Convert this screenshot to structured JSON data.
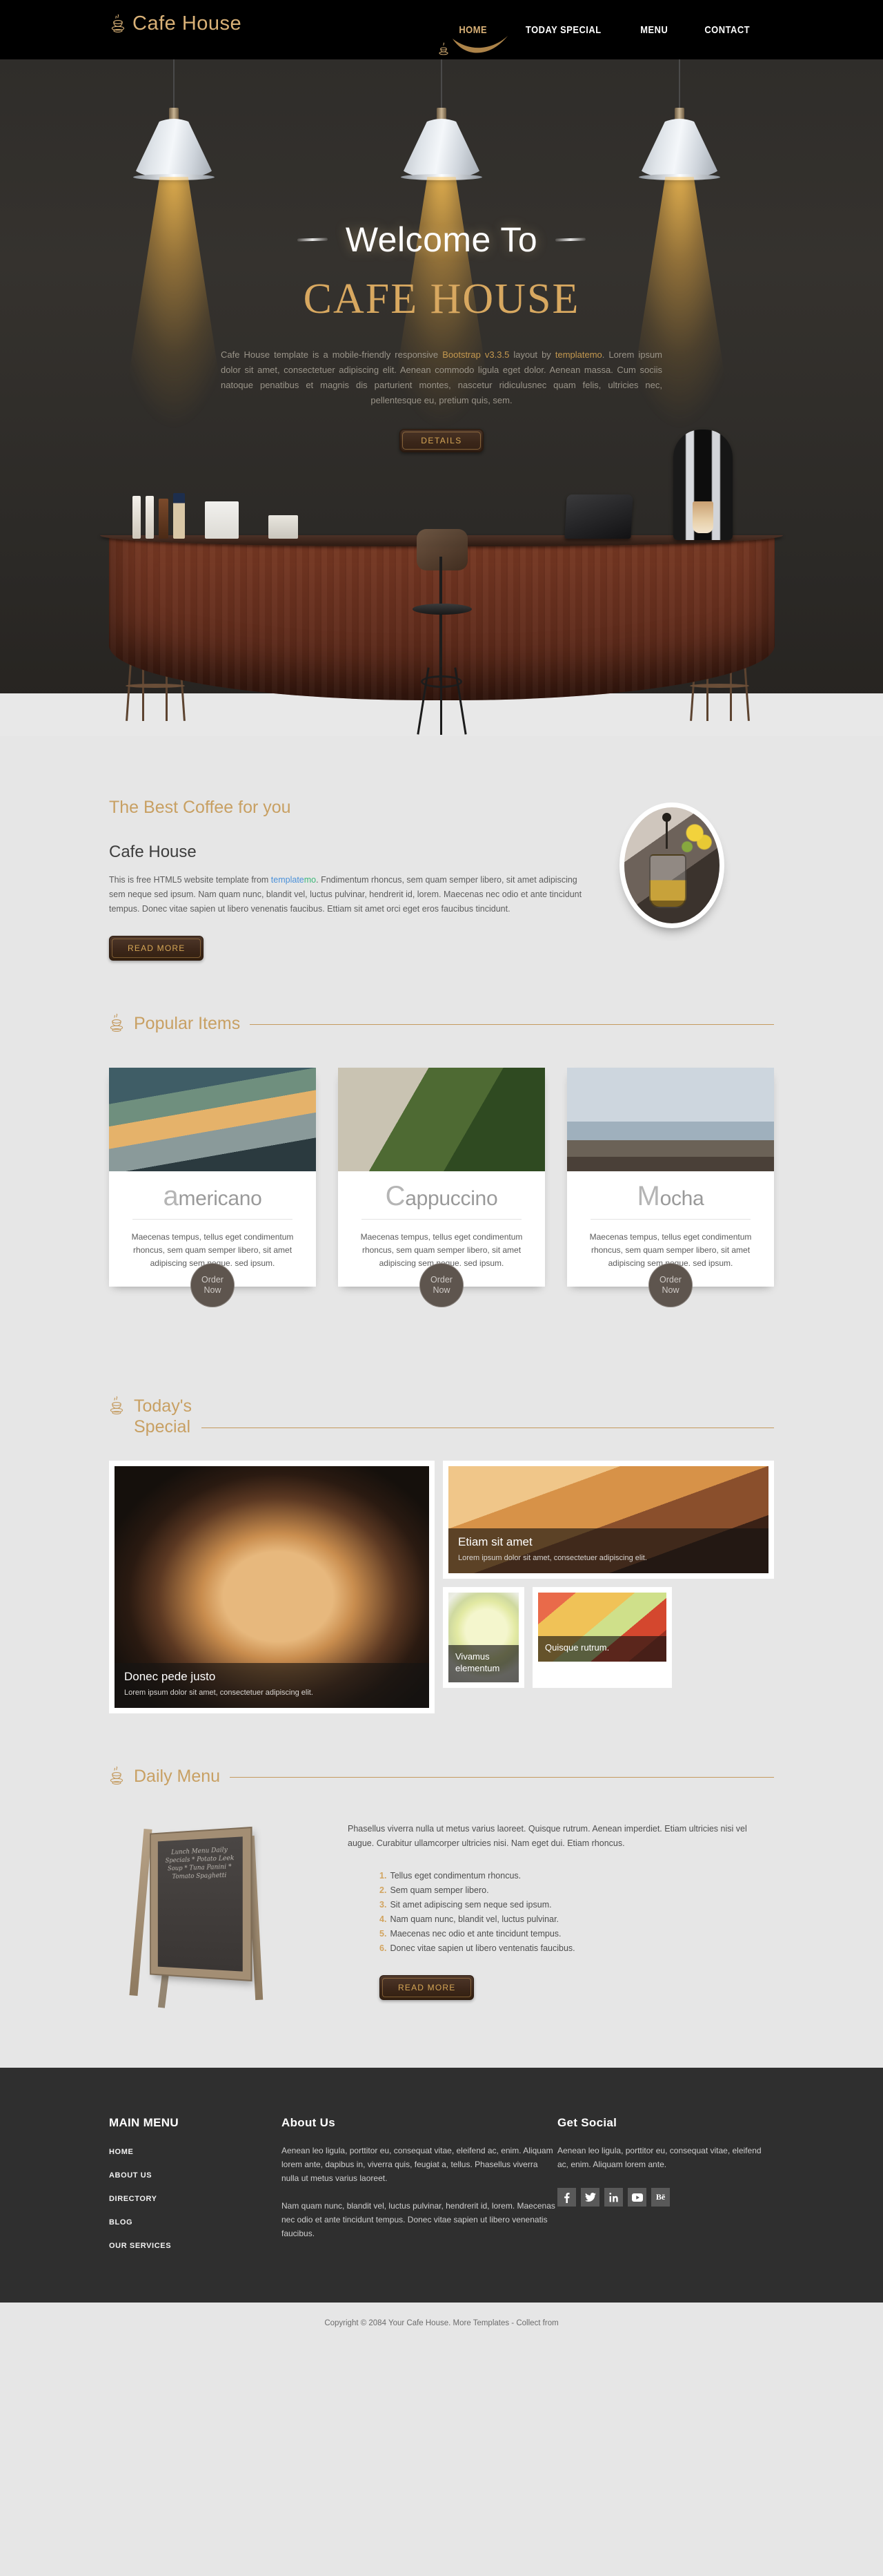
{
  "brand": {
    "name": "Cafe House",
    "icon": "coffee-cup-icon"
  },
  "nav": {
    "items": [
      {
        "label": "HOME",
        "active": true
      },
      {
        "label": "TODAY SPECIAL",
        "active": false
      },
      {
        "label": "MENU",
        "active": false
      },
      {
        "label": "CONTACT",
        "active": false
      }
    ]
  },
  "hero": {
    "welcome": "Welcome To",
    "title": "CAFE HOUSE",
    "paragraph_1": "Cafe House template is a mobile-friendly responsive ",
    "link_1": "Bootstrap v3.3.5",
    "paragraph_2": " layout by ",
    "link_2": "templatemo",
    "paragraph_3": ". Lorem ipsum dolor sit amet, consectetuer adipiscing elit. Aenean commodo ligula eget dolor. Aenean massa. Cum sociis natoque penatibus et magnis dis parturient montes, nascetur ridiculusnec quam felis, ultricies nec, pellentesque eu, pretium quis, sem.",
    "button": "DETAILS"
  },
  "about": {
    "heading": "The Best Coffee for you",
    "subheading": "Cafe House",
    "text_before_link": "This is free HTML5 website template from ",
    "link_a": "template",
    "link_b": "mo",
    "text_after_link": ". Fndimentum rhoncus, sem quam semper libero, sit amet adipiscing sem neque sed ipsum. Nam quam nunc, blandit vel, luctus pulvinar, hendrerit id, lorem. Maecenas nec odio et ante tincidunt tempus. Donec vitae sapien ut libero venenatis faucibus. Ettiam sit amet orci eget eros faucibus tincidunt.",
    "button": "READ MORE"
  },
  "popular": {
    "title": "Popular Items",
    "icon": "coffee-cup-icon",
    "cards": [
      {
        "initial": "a",
        "rest": "mericano",
        "desc": "Maecenas tempus, tellus eget condimentum rhoncus, sem quam semper libero, sit amet adipiscing sem neque. sed ipsum.",
        "order_line1": "Order",
        "order_line2": "Now"
      },
      {
        "initial": "C",
        "rest": "appuccino",
        "desc": "Maecenas tempus, tellus eget condimentum rhoncus, sem quam semper libero, sit amet adipiscing sem neque. sed ipsum.",
        "order_line1": "Order",
        "order_line2": "Now"
      },
      {
        "initial": "M",
        "rest": "ocha",
        "desc": "Maecenas tempus, tellus eget condimentum rhoncus, sem quam semper libero, sit amet adipiscing sem neque. sed ipsum.",
        "order_line1": "Order",
        "order_line2": "Now"
      }
    ]
  },
  "special": {
    "title": "Today's\nSpecial",
    "icon": "coffee-cup-icon",
    "tiles": [
      {
        "title": "Donec pede justo",
        "desc": "Lorem ipsum dolor sit amet, consectetuer adipiscing elit."
      },
      {
        "title": "Etiam sit amet",
        "desc": "Lorem ipsum dolor sit amet, consectetuer adipiscing elit."
      },
      {
        "title": "Vivamus elementum",
        "desc": ""
      },
      {
        "title": "Quisque rutrum.",
        "desc": ""
      }
    ]
  },
  "daily": {
    "title": "Daily Menu",
    "icon": "coffee-cup-icon",
    "chalkboard": "Lunch Menu\nDaily Specials\n* Potato Leek Soup\n* Tuna Panini\n* Tomato Spaghetti",
    "intro": "Phasellus viverra nulla ut metus varius laoreet. Quisque rutrum. Aenean imperdiet. Etiam ultricies nisi vel augue. Curabitur ullamcorper ultricies nisi. Nam eget dui. Etiam rhoncus.",
    "items": [
      {
        "num": "1.",
        "text": "Tellus eget condimentum rhoncus."
      },
      {
        "num": "2.",
        "text": "Sem quam semper libero."
      },
      {
        "num": "3.",
        "text": "Sit amet adipiscing sem neque sed ipsum."
      },
      {
        "num": "4.",
        "text": "Nam quam nunc, blandit vel, luctus pulvinar."
      },
      {
        "num": "5.",
        "text": "Maecenas nec odio et ante tincidunt tempus."
      },
      {
        "num": "6.",
        "text": "Donec vitae sapien ut libero ventenatis faucibus."
      }
    ],
    "button": "READ MORE"
  },
  "footer": {
    "menu_title": "MAIN MENU",
    "menu_items": [
      "HOME",
      "ABOUT US",
      "DIRECTORY",
      "BLOG",
      "OUR SERVICES"
    ],
    "about_title": "About Us",
    "about_p1": "Aenean leo ligula, porttitor eu, consequat vitae, eleifend ac, enim. Aliquam lorem ante, dapibus in, viverra quis, feugiat a, tellus. Phasellus viverra nulla ut metus varius laoreet.",
    "about_p2": "Nam quam nunc, blandit vel, luctus pulvinar, hendrerit id, lorem. Maecenas nec odio et ante tincidunt tempus. Donec vitae sapien ut libero venenatis faucibus.",
    "social_title": "Get Social",
    "social_p": "Aenean leo ligula, porttitor eu, consequat vitae, eleifend ac, enim. Aliquam lorem ante.",
    "socials": [
      "facebook-icon",
      "twitter-icon",
      "linkedin-icon",
      "youtube-icon",
      "behance-icon"
    ]
  },
  "copyright": {
    "text": "Copyright © 2084 Your Cafe House. More Templates - Collect from"
  },
  "colors": {
    "gold": "#c8a063",
    "dark": "#2f2f2f",
    "page_bg": "#e6e6e6",
    "accent_link": "#4a90d9"
  }
}
